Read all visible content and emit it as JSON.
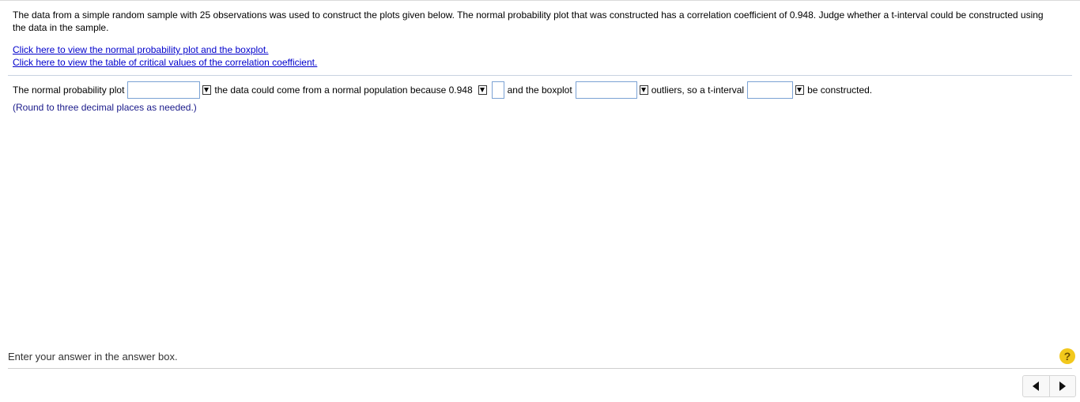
{
  "question": {
    "text": "The data from a simple random sample with 25 observations was used to construct the plots given below. The normal probability plot that was constructed has a correlation coefficient of 0.948. Judge whether a t-interval could be constructed using the data in the sample."
  },
  "links": {
    "plots": "Click here to view the normal probability plot and the boxplot.",
    "table": "Click here to view the table of critical values of the correlation coefficient."
  },
  "answer": {
    "part1": "The normal probability plot",
    "part2": "the data could come from a normal population because 0.948",
    "part3": "and the boxplot",
    "part4": "outliers, so a t-interval",
    "part5": "be constructed.",
    "dropdown1_value": "",
    "dropdown2_value": "",
    "number_value": "",
    "dropdown3_value": "",
    "dropdown4_value": ""
  },
  "note": "(Round to three decimal places as needed.)",
  "footer": {
    "instruction": "Enter your answer in the answer box.",
    "help_symbol": "?"
  },
  "icons": {
    "help": "help-icon",
    "prev": "arrow-left-icon",
    "next": "arrow-right-icon",
    "dropdown": "chevron-down-icon"
  },
  "colors": {
    "link": "#0000cc",
    "note": "#1a1a8a",
    "input_border": "#7ba2d4",
    "help_bg": "#f2c81c"
  }
}
